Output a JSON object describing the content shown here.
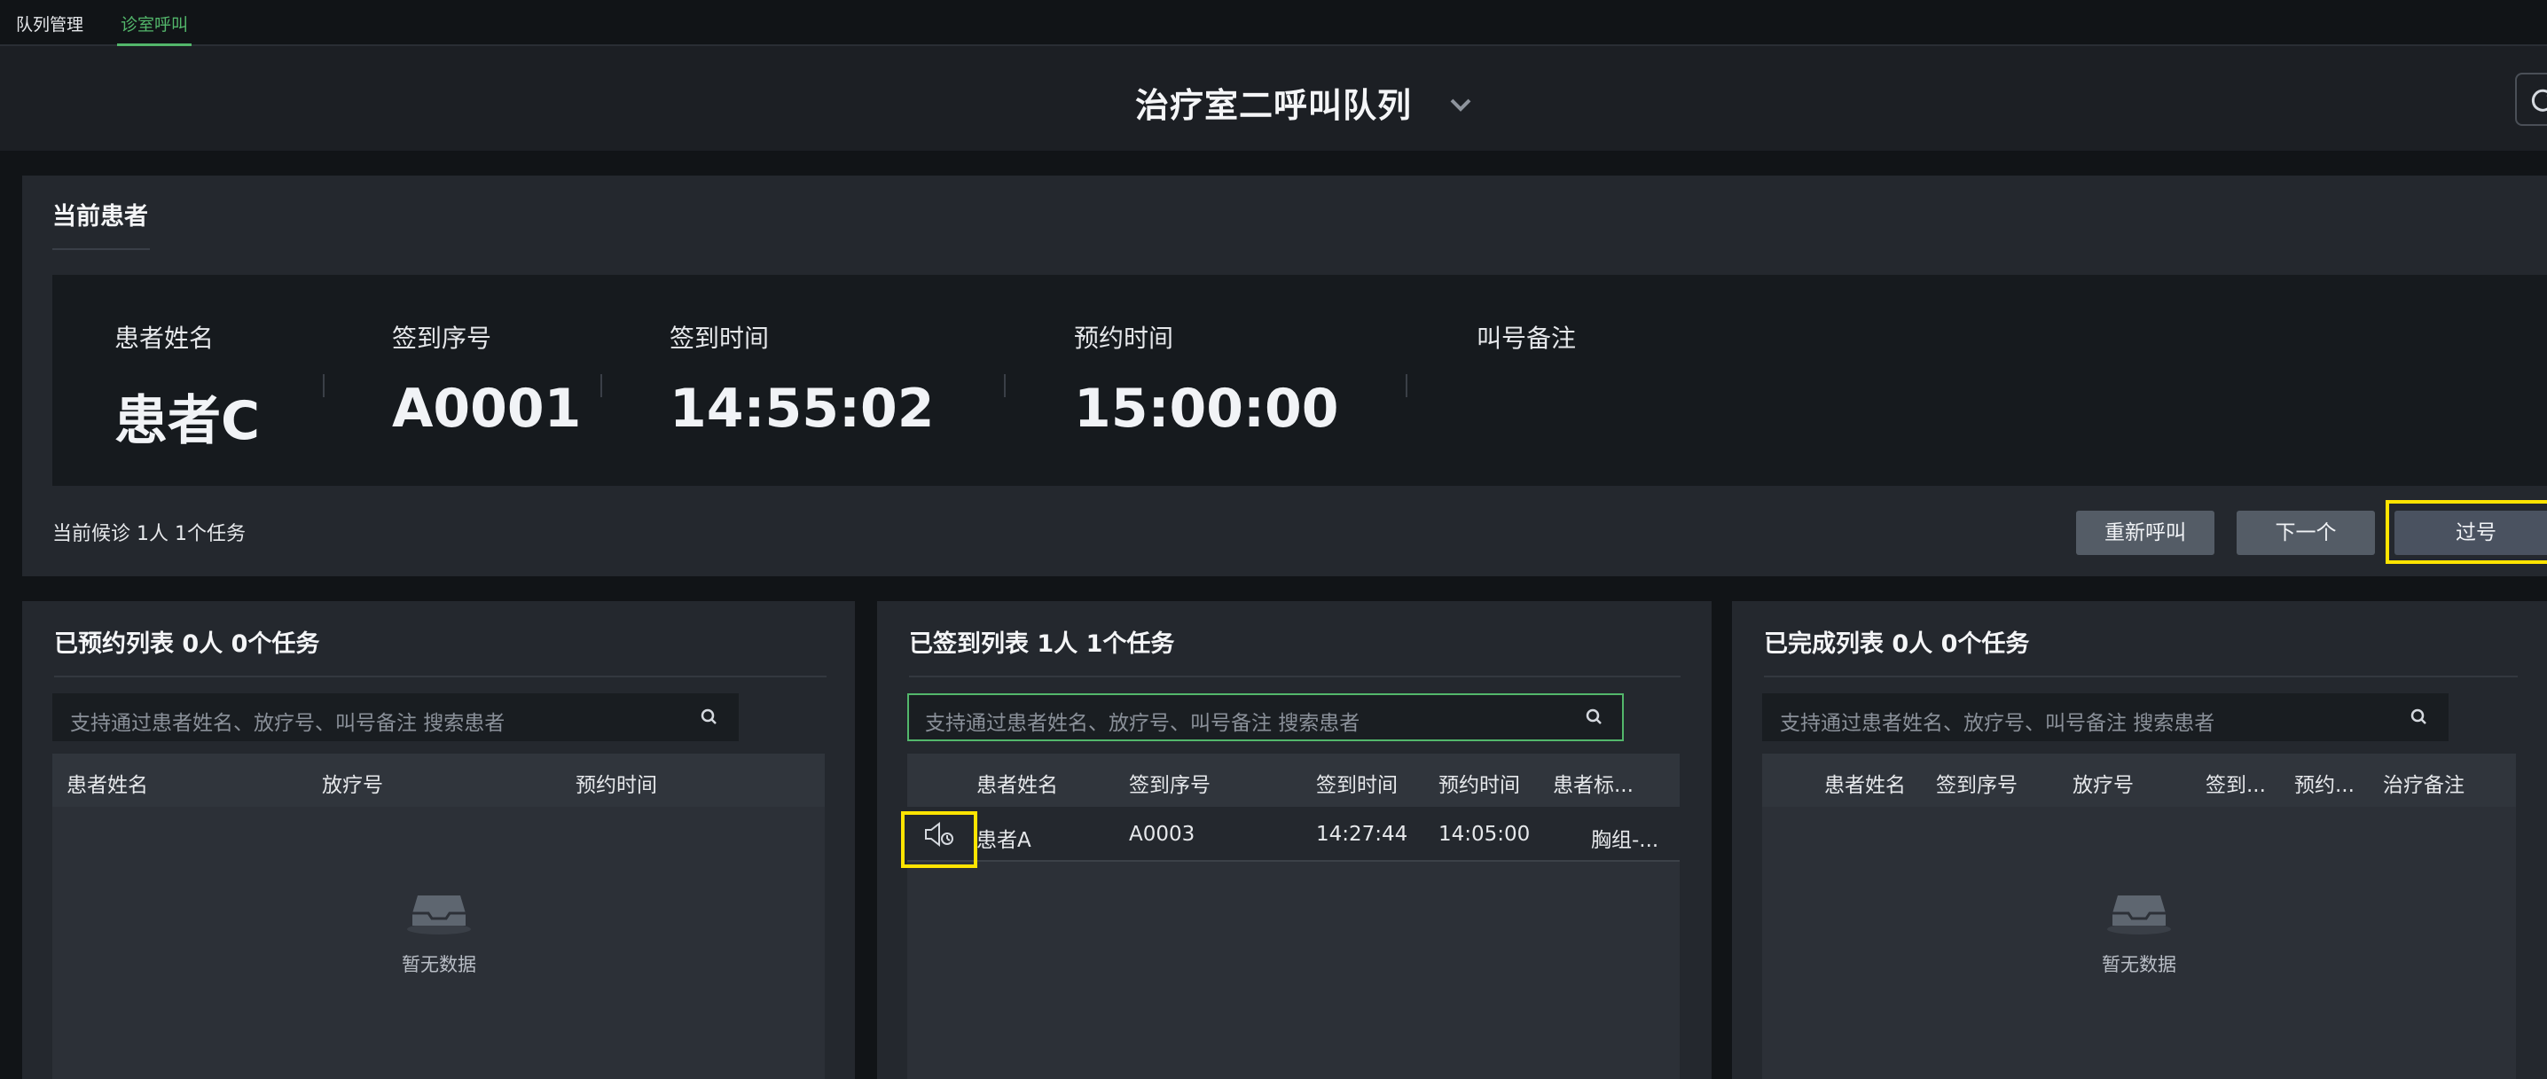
{
  "tabs": [
    {
      "label": "队列管理"
    },
    {
      "label": "诊室呼叫"
    }
  ],
  "header": {
    "title": "治疗室二呼叫队列"
  },
  "current": {
    "title": "当前患者",
    "fields": [
      {
        "label": "患者姓名",
        "value": "患者C"
      },
      {
        "label": "签到序号",
        "value": "A0001"
      },
      {
        "label": "签到时间",
        "value": "14:55:02"
      },
      {
        "label": "预约时间",
        "value": "15:00:00"
      },
      {
        "label": "叫号备注",
        "value": ""
      }
    ],
    "waiting": "当前候诊 1人 1个任务",
    "buttons": {
      "recall": "重新呼叫",
      "next": "下一个",
      "skip": "过号"
    }
  },
  "booked": {
    "title": "已预约列表 0人 0个任务",
    "placeholder": "支持通过患者姓名、放疗号、叫号备注 搜索患者",
    "columns": [
      "患者姓名",
      "放疗号",
      "预约时间"
    ],
    "empty": "暂无数据"
  },
  "checked": {
    "title": "已签到列表 1人 1个任务",
    "placeholder": "支持通过患者姓名、放疗号、叫号备注 搜索患者",
    "columns": [
      "患者姓名",
      "签到序号",
      "签到时间",
      "预约时间",
      "患者标..."
    ],
    "rows": [
      {
        "name": "患者A",
        "seq": "A0003",
        "checkin": "14:27:44",
        "appoint": "14:05:00",
        "tag": "胸组-..."
      }
    ]
  },
  "done": {
    "title": "已完成列表 0人 0个任务",
    "placeholder": "支持通过患者姓名、放疗号、叫号备注 搜索患者",
    "columns": [
      "患者姓名",
      "签到序号",
      "放疗号",
      "签到...",
      "预约...",
      "治疗备注"
    ],
    "empty": "暂无数据"
  },
  "colors": {
    "accent": "#53b76b",
    "highlight": "#ffe400"
  },
  "icons": [
    "chevron-down-icon",
    "refresh-icon",
    "search-icon",
    "speaker-icon",
    "empty-inbox-icon"
  ]
}
